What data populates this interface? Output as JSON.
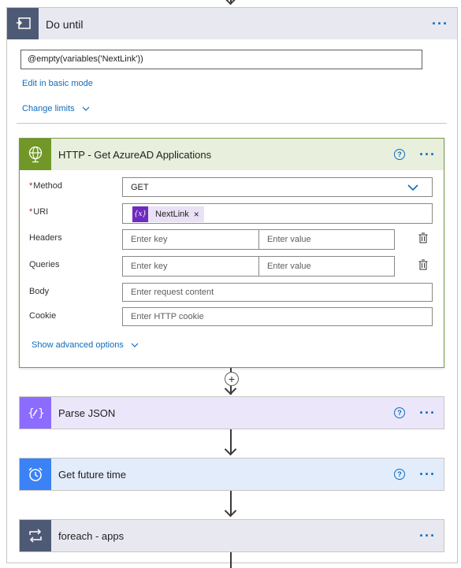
{
  "do_until": {
    "title": "Do until",
    "condition": "@empty(variables('NextLink'))",
    "edit_basic_label": "Edit in basic mode",
    "change_limits_label": "Change limits"
  },
  "http_action": {
    "title": "HTTP - Get AzureAD Applications",
    "fields": {
      "method": {
        "label": "Method",
        "value": "GET",
        "required": true
      },
      "uri": {
        "label": "URI",
        "token": "NextLink",
        "token_icon": "{x}",
        "required": true
      },
      "headers": {
        "label": "Headers",
        "key_placeholder": "Enter key",
        "value_placeholder": "Enter value"
      },
      "queries": {
        "label": "Queries",
        "key_placeholder": "Enter key",
        "value_placeholder": "Enter value"
      },
      "body": {
        "label": "Body",
        "placeholder": "Enter request content"
      },
      "cookie": {
        "label": "Cookie",
        "placeholder": "Enter HTTP cookie"
      }
    },
    "advanced_label": "Show advanced options"
  },
  "actions": [
    {
      "title": "Parse JSON",
      "icon": "parse-json-icon"
    },
    {
      "title": "Get future time",
      "icon": "alarm-clock-icon"
    },
    {
      "title": "foreach - apps",
      "icon": "loop-icon"
    }
  ],
  "colors": {
    "do_until_icon": "#4e5a75",
    "http_icon": "#709727",
    "parse_json_icon": "#8c6cff",
    "time_icon": "#3b82f6",
    "foreach_icon": "#4e5a75",
    "link": "#0f6cbd"
  }
}
